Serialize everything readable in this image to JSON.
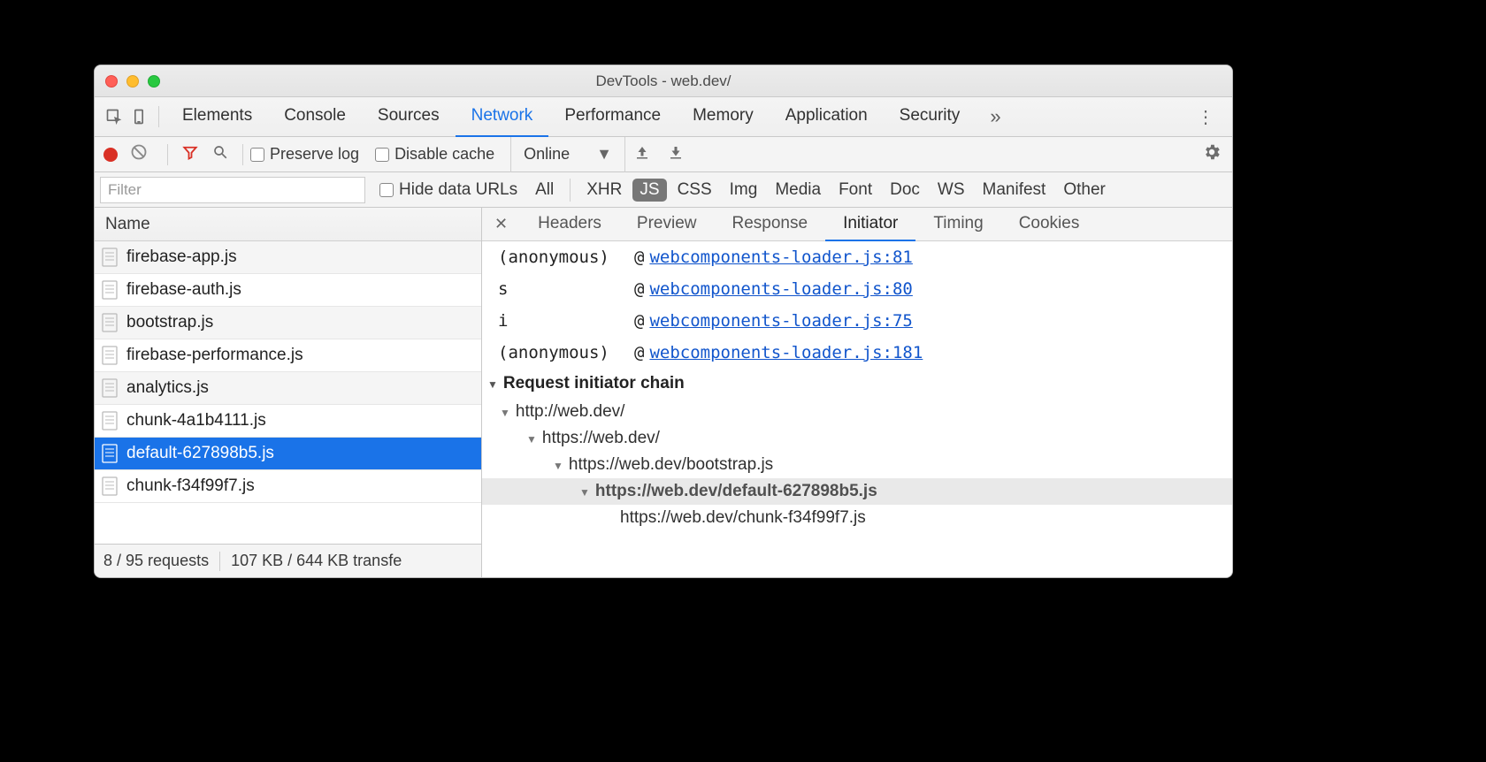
{
  "window": {
    "title": "DevTools - web.dev/"
  },
  "main_tabs": {
    "items": [
      "Elements",
      "Console",
      "Sources",
      "Network",
      "Performance",
      "Memory",
      "Application",
      "Security"
    ],
    "selected": "Network",
    "overflow_glyph": "»",
    "menu_glyph": "⋮"
  },
  "toolbar": {
    "preserve_log": "Preserve log",
    "disable_cache": "Disable cache",
    "throttle": "Online",
    "dropdown_glyph": "▼"
  },
  "filter_bar": {
    "placeholder": "Filter",
    "hide_urls": "Hide data URLs",
    "types": [
      "All",
      "XHR",
      "JS",
      "CSS",
      "Img",
      "Media",
      "Font",
      "Doc",
      "WS",
      "Manifest",
      "Other"
    ],
    "active_type": "JS"
  },
  "left": {
    "header": "Name",
    "rows": [
      {
        "name": "firebase-app.js",
        "selected": false
      },
      {
        "name": "firebase-auth.js",
        "selected": false
      },
      {
        "name": "bootstrap.js",
        "selected": false
      },
      {
        "name": "firebase-performance.js",
        "selected": false
      },
      {
        "name": "analytics.js",
        "selected": false
      },
      {
        "name": "chunk-4a1b4111.js",
        "selected": false
      },
      {
        "name": "default-627898b5.js",
        "selected": true
      },
      {
        "name": "chunk-f34f99f7.js",
        "selected": false
      }
    ],
    "footer": {
      "requests": "8 / 95 requests",
      "transfer": "107 KB / 644 KB transfe"
    }
  },
  "detail_tabs": {
    "items": [
      "Headers",
      "Preview",
      "Response",
      "Initiator",
      "Timing",
      "Cookies"
    ],
    "selected": "Initiator"
  },
  "stack": [
    {
      "fn": "(anonymous)",
      "at": "@",
      "link": "webcomponents-loader.js:81"
    },
    {
      "fn": "s",
      "at": "@",
      "link": "webcomponents-loader.js:80"
    },
    {
      "fn": "i",
      "at": "@",
      "link": "webcomponents-loader.js:75"
    },
    {
      "fn": "(anonymous)",
      "at": "@",
      "link": "webcomponents-loader.js:181"
    }
  ],
  "chain": {
    "header": "Request initiator chain",
    "nodes": [
      {
        "indent": 0,
        "label": "http://web.dev/",
        "current": false,
        "leaf": false
      },
      {
        "indent": 1,
        "label": "https://web.dev/",
        "current": false,
        "leaf": false
      },
      {
        "indent": 2,
        "label": "https://web.dev/bootstrap.js",
        "current": false,
        "leaf": false
      },
      {
        "indent": 3,
        "label": "https://web.dev/default-627898b5.js",
        "current": true,
        "leaf": false
      },
      {
        "indent": 4,
        "label": "https://web.dev/chunk-f34f99f7.js",
        "current": false,
        "leaf": true
      }
    ]
  }
}
